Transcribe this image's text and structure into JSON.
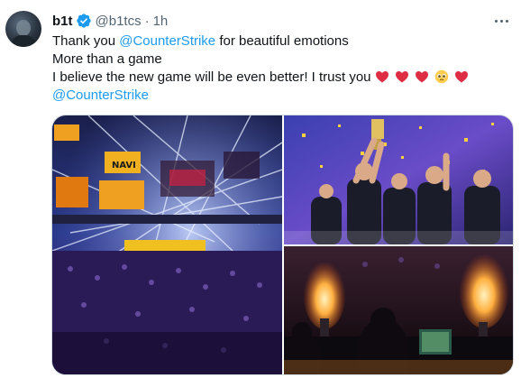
{
  "tweet": {
    "author_name": "b1t",
    "handle": "@b1tcs",
    "separator": "·",
    "time": "1h",
    "lines": [
      [
        "Thank you ",
        "@CounterStrike",
        " for beautiful emotions"
      ],
      [
        "More than a game"
      ],
      [
        "I believe the new game will be even better! I trust you "
      ],
      [
        "@CounterStrike"
      ]
    ],
    "emoji": [
      "red-heart",
      "red-heart",
      "red-heart",
      "pleading-face",
      "red-heart"
    ]
  },
  "colors": {
    "text": "#0f1419",
    "secondary": "#536471",
    "mention": "#1d9bf0",
    "verified": "#1d9bf0",
    "border": "#cfd9de"
  },
  "media": {
    "images": [
      "arena-stage-lights-photo",
      "trophy-celebration-photo",
      "player-pyro-flames-photo"
    ],
    "logo_text": "NAVI"
  }
}
